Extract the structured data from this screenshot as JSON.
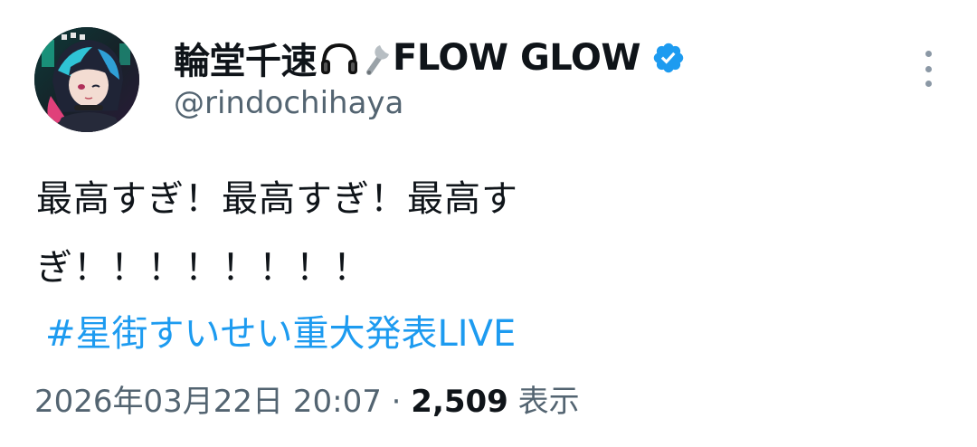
{
  "author": {
    "display_name": "輪堂千速",
    "headphones_icon": "🎧",
    "wrench_icon": "wrench-icon",
    "name_suffix": "FLOW GLOW",
    "handle": "@rindochihaya",
    "verified": true,
    "verified_color": "#1d9bf0"
  },
  "tweet": {
    "text": "最高すぎ！最高すぎ！最高すぎ！！！！！！！！",
    "hashtag": "#星街すいせい重大発表LIVE",
    "hashtag_color": "#1d9bf0"
  },
  "meta": {
    "timestamp": "2026年03月22日 20:07",
    "separator": "·",
    "views": "2,509",
    "views_label": "表示"
  }
}
